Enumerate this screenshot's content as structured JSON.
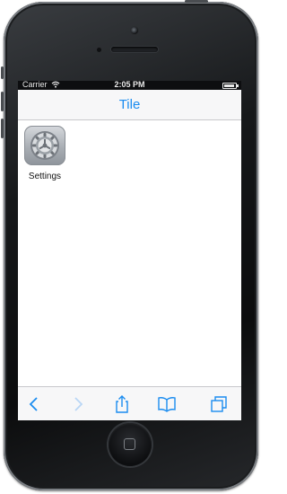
{
  "status_bar": {
    "carrier": "Carrier",
    "time": "2:05 PM",
    "battery_level": 0.9,
    "wifi_icon": "wifi-icon"
  },
  "navbar": {
    "title": "Tile"
  },
  "tiles": [
    {
      "label": "Settings",
      "icon": "settings-gear-icon"
    }
  ],
  "toolbar": {
    "items": [
      {
        "name": "back",
        "icon": "chevron-left-icon",
        "enabled": true
      },
      {
        "name": "forward",
        "icon": "chevron-right-icon",
        "enabled": false
      },
      {
        "name": "share",
        "icon": "share-icon",
        "enabled": true
      },
      {
        "name": "bookmarks",
        "icon": "book-icon",
        "enabled": true
      },
      {
        "name": "tabs",
        "icon": "tabs-icon",
        "enabled": true
      }
    ]
  },
  "colors": {
    "accent": "#1a8cf0",
    "disabled": "#b9d6f5",
    "bar_background": "#f7f7f8",
    "phone_body": "#0b0c0d"
  }
}
